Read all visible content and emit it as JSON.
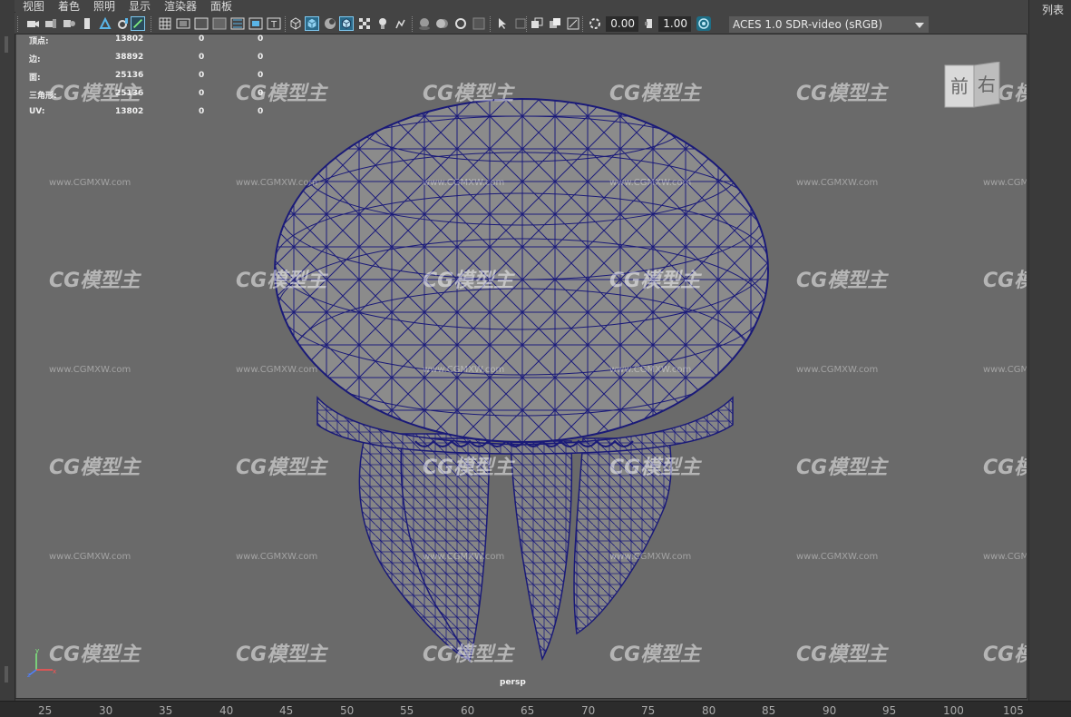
{
  "menu": {
    "items": [
      "视图",
      "着色",
      "照明",
      "显示",
      "渲染器",
      "面板"
    ]
  },
  "toolbar": {
    "field1": "0.00",
    "field2": "1.00",
    "color_space": "ACES 1.0 SDR-video (sRGB)"
  },
  "hud_stats": [
    {
      "label": "顶点:",
      "total": "13802",
      "selected": "0",
      "tris": "0"
    },
    {
      "label": "边:",
      "total": "38892",
      "selected": "0",
      "tris": "0"
    },
    {
      "label": "面:",
      "total": "25136",
      "selected": "0",
      "tris": "0"
    },
    {
      "label": "三角形:",
      "total": "25136",
      "selected": "0",
      "tris": "0"
    },
    {
      "label": "UV:",
      "total": "13802",
      "selected": "0",
      "tris": "0"
    }
  ],
  "viewcube": {
    "front": "前",
    "right": "右"
  },
  "camera_label": "persp",
  "right_panel": {
    "title": "列表"
  },
  "timeline": {
    "ticks": [
      "25",
      "30",
      "35",
      "40",
      "45",
      "50",
      "55",
      "60",
      "65",
      "70",
      "75",
      "80",
      "85",
      "90",
      "95",
      "100",
      "105"
    ]
  },
  "watermark": {
    "logo": "CG模型主",
    "url": "www.CGMXW.com"
  },
  "colors": {
    "viewport_bg": "#6a6a6a",
    "wireframe": "#1a1a78",
    "mesh_fill": "#8a8a8a",
    "ui_bg": "#444444"
  }
}
